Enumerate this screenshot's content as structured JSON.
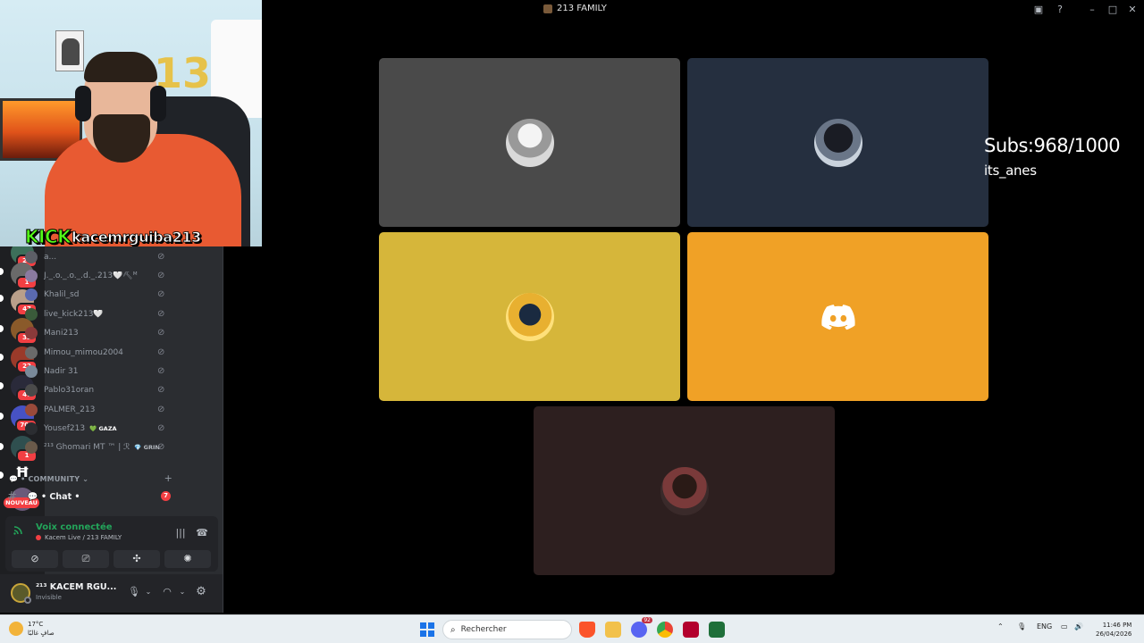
{
  "window": {
    "title": "213 FAMILY",
    "controls": [
      "screen-icon",
      "help-icon",
      "minimize-icon",
      "maximize-icon",
      "close-icon"
    ]
  },
  "webcam": {
    "brand": "KICK",
    "channel": "kacemrguiba213",
    "balloon_text": "213"
  },
  "overlay": {
    "subs": "Subs:968/1000",
    "user": "its_anes"
  },
  "server_rail": {
    "badges": [
      "24",
      "1",
      "47",
      "32",
      "22",
      "47",
      "709",
      "1"
    ],
    "new_label": "NOUVEAU"
  },
  "members": [
    {
      "name": "a..."
    },
    {
      "name": "J._.o._.o._.d._.213🤍⛏ᴹ"
    },
    {
      "name": "Khalil_sd"
    },
    {
      "name": "live_kick213🤍"
    },
    {
      "name": "Mani213"
    },
    {
      "name": "Mimou_mimou2004"
    },
    {
      "name": "Nadir 31"
    },
    {
      "name": "Pablo31oran"
    },
    {
      "name": "PALMER_213"
    },
    {
      "name": "Yousef213",
      "tag": "💚 GAZA"
    },
    {
      "name": "²¹³ Ghomari MT ™ | ℛ",
      "tag": "💎 GRIN"
    }
  ],
  "category": {
    "label": "💬 • COMMUNITY ⌄"
  },
  "channel": {
    "label": "💬 • Chat •",
    "count": "7"
  },
  "voice": {
    "status": "Voix connectée",
    "location": "Kacem Live / 213 FAMILY"
  },
  "user": {
    "name": "²¹³ KACEM RGU...",
    "status": "Invisible"
  },
  "tiles": [
    {
      "id": "p1",
      "bg": "#4a4a4a"
    },
    {
      "id": "p2",
      "bg": "#252f3f"
    },
    {
      "id": "p3",
      "bg": "#d6b63a"
    },
    {
      "id": "p4",
      "bg": "#f0a126"
    },
    {
      "id": "p5",
      "bg": "#2d1f1f"
    }
  ],
  "taskbar": {
    "temp": "17°C",
    "weather": "صافٍ غالبًا",
    "search_placeholder": "Rechercher",
    "lang": "ENG",
    "time": "11:46 PM",
    "date": "26/04/2026",
    "discord_badge": "92"
  },
  "colors": {
    "discord_green": "#23a55a",
    "danger": "#f23f43",
    "kick_green": "#53fc18"
  }
}
